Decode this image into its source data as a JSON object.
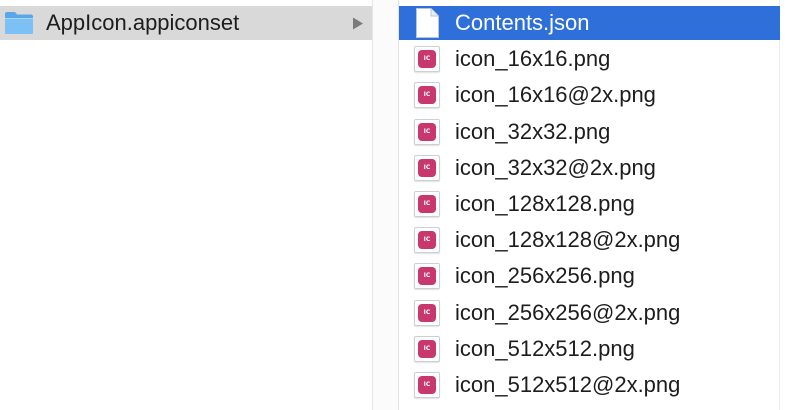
{
  "left_column": {
    "folder": {
      "name": "AppIcon.appiconset",
      "icon": "folder-icon",
      "selected_inactive": true
    }
  },
  "right_column": {
    "files": [
      {
        "name": "Contents.json",
        "icon": "json-document-icon",
        "selected": true
      },
      {
        "name": "icon_16x16.png",
        "icon": "png-image-icon",
        "selected": false
      },
      {
        "name": "icon_16x16@2x.png",
        "icon": "png-image-icon",
        "selected": false
      },
      {
        "name": "icon_32x32.png",
        "icon": "png-image-icon",
        "selected": false
      },
      {
        "name": "icon_32x32@2x.png",
        "icon": "png-image-icon",
        "selected": false
      },
      {
        "name": "icon_128x128.png",
        "icon": "png-image-icon",
        "selected": false
      },
      {
        "name": "icon_128x128@2x.png",
        "icon": "png-image-icon",
        "selected": false
      },
      {
        "name": "icon_256x256.png",
        "icon": "png-image-icon",
        "selected": false
      },
      {
        "name": "icon_256x256@2x.png",
        "icon": "png-image-icon",
        "selected": false
      },
      {
        "name": "icon_512x512.png",
        "icon": "png-image-icon",
        "selected": false
      },
      {
        "name": "icon_512x512@2x.png",
        "icon": "png-image-icon",
        "selected": false
      }
    ]
  },
  "thumbnail_badge_text": "IC",
  "colors": {
    "selection_active": "#2f6fd9",
    "selection_inactive": "#d9d9d9",
    "folder_blue": "#6db3f2",
    "icon_tile": "#c8386e"
  }
}
